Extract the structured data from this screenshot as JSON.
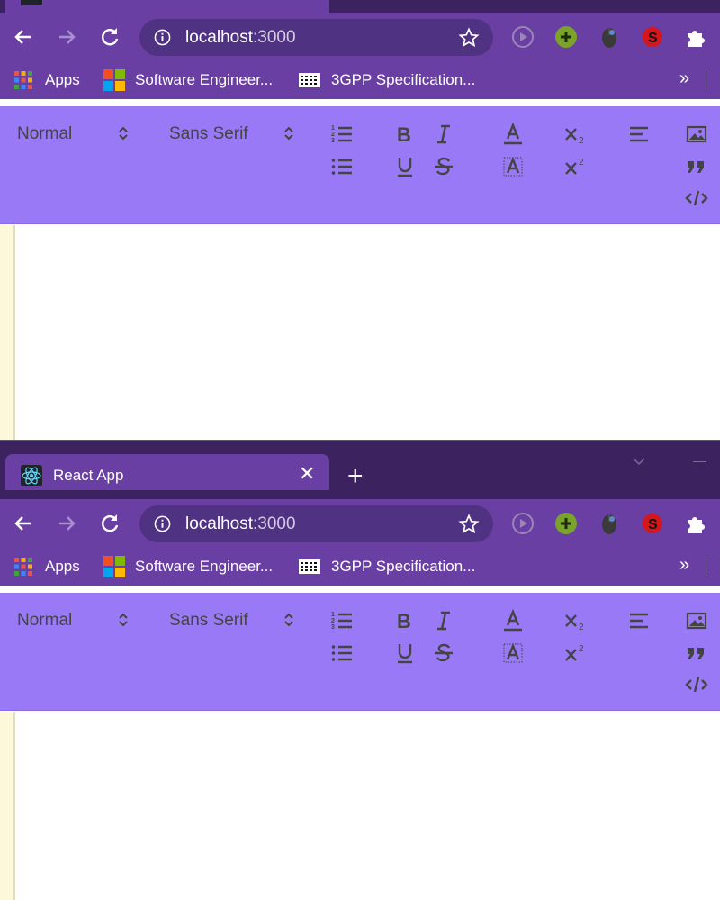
{
  "browser": {
    "tab_title": "React App",
    "tab_close": "✕",
    "new_tab": "+",
    "url_host": "localhost",
    "url_port": ":3000",
    "bookmarks": [
      {
        "label": "Apps"
      },
      {
        "label": "Software Engineer..."
      },
      {
        "label": "3GPP Specification..."
      }
    ],
    "bookmarks_more": "»"
  },
  "editor": {
    "header_picker": "Normal",
    "font_picker": "Sans Serif",
    "colors": {
      "tabstrip": "#3c2360",
      "toolbar": "#6a3fa3",
      "editor_toolbar": "#9a79f6",
      "icon": "#444444",
      "gutter": "#fef8da"
    },
    "buttons": [
      "ordered-list",
      "bullet-list",
      "bold",
      "italic",
      "underline",
      "strike",
      "text-color",
      "background-color",
      "subscript",
      "superscript",
      "align",
      "image",
      "blockquote",
      "code-block"
    ]
  }
}
